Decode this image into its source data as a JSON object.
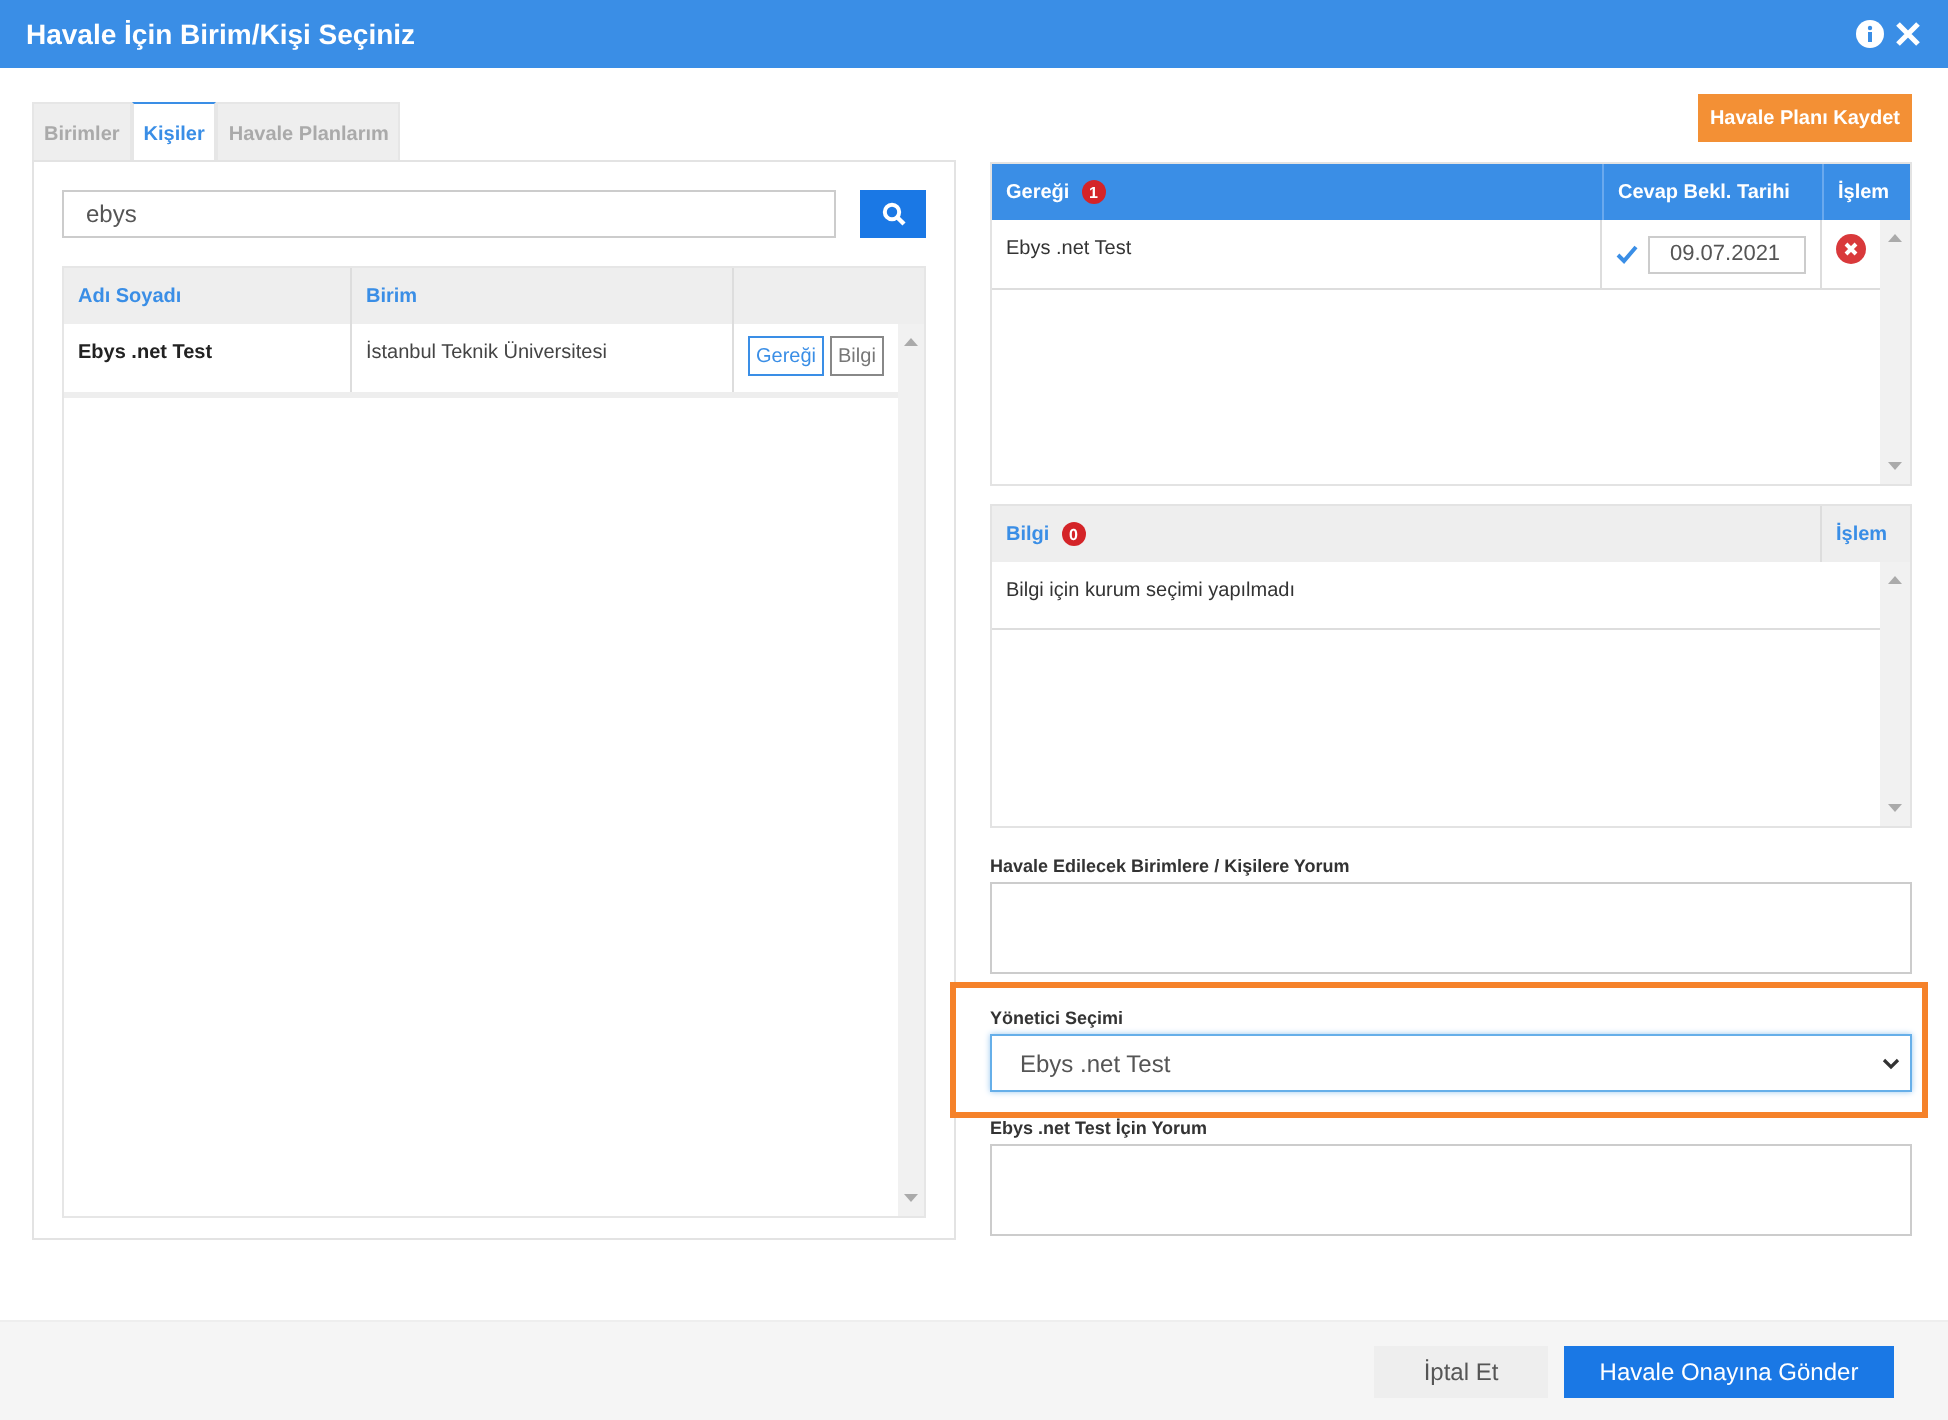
{
  "window": {
    "title": "Havale İçin Birim/Kişi Seçiniz"
  },
  "tabs": [
    {
      "label": "Birimler",
      "selected": false
    },
    {
      "label": "Kişiler",
      "selected": true
    },
    {
      "label": "Havale Planlarım",
      "selected": false
    }
  ],
  "search": {
    "value": "ebys"
  },
  "people_table": {
    "columns": [
      "Adı Soyadı",
      "Birim"
    ],
    "rows": [
      {
        "name": "Ebys .net Test",
        "unit": "İstanbul Teknik Üniversitesi",
        "actions": [
          "Gereği",
          "Bilgi"
        ]
      }
    ]
  },
  "save_plan_button": "Havale Planı Kaydet",
  "action_table": {
    "title": "Gereği",
    "count": "1",
    "columns": [
      "Cevap Bekl. Tarihi",
      "İşlem"
    ],
    "rows": [
      {
        "name": "Ebys .net Test",
        "checked": true,
        "date": "09.07.2021"
      }
    ]
  },
  "info_table": {
    "title": "Bilgi",
    "count": "0",
    "action_column": "İşlem",
    "empty_message": "Bilgi için kurum seçimi yapılmadı"
  },
  "comment": {
    "label": "Havale Edilecek Birimlere / Kişilere Yorum"
  },
  "manager_select": {
    "label": "Yönetici Seçimi",
    "value": "Ebys .net Test",
    "highlighted": true
  },
  "manager_comment": {
    "label": "Ebys .net Test İçin Yorum"
  },
  "buttons": [
    {
      "label": "İptal Et",
      "kind": "secondary"
    },
    {
      "label": "Havale Onayına Gönder",
      "kind": "primary"
    }
  ]
}
